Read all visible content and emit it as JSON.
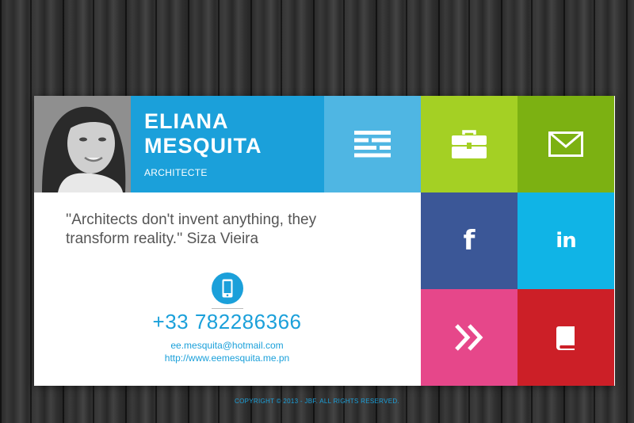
{
  "profile": {
    "first_name": "ELIANA",
    "last_name": "MESQUITA",
    "role": "ARCHITECTE",
    "photo_alt": "profile-photo"
  },
  "tiles": [
    {
      "name": "menu",
      "icon": "menu-icon",
      "color": "#4fb6e3"
    },
    {
      "name": "portfolio",
      "icon": "briefcase-icon",
      "color": "#a4d024"
    },
    {
      "name": "mail",
      "icon": "envelope-icon",
      "color": "#7cb112"
    },
    {
      "name": "facebook",
      "icon": "facebook-icon",
      "color": "#3b5797",
      "glyph": "f"
    },
    {
      "name": "linkedin",
      "icon": "linkedin-icon",
      "color": "#10b4e6",
      "glyph": "in"
    },
    {
      "name": "more",
      "icon": "double-chevron-right-icon",
      "color": "#e6478a"
    },
    {
      "name": "blog",
      "icon": "book-icon",
      "color": "#cc1f27"
    }
  ],
  "quote": "''Architects don't invent anything, they transform reality.'' Siza Vieira",
  "contact": {
    "phone": "+33 782286366",
    "email": "ee.mesquita@hotmail.com",
    "website": "http://www.eemesquita.me.pn"
  },
  "footer": "COPYRIGHT © 2013 - JBF. ALL RIGHTS RESERVED.",
  "colors": {
    "accent": "#1ba0da",
    "card": "#ffffff",
    "background": "#2e2e2e"
  }
}
